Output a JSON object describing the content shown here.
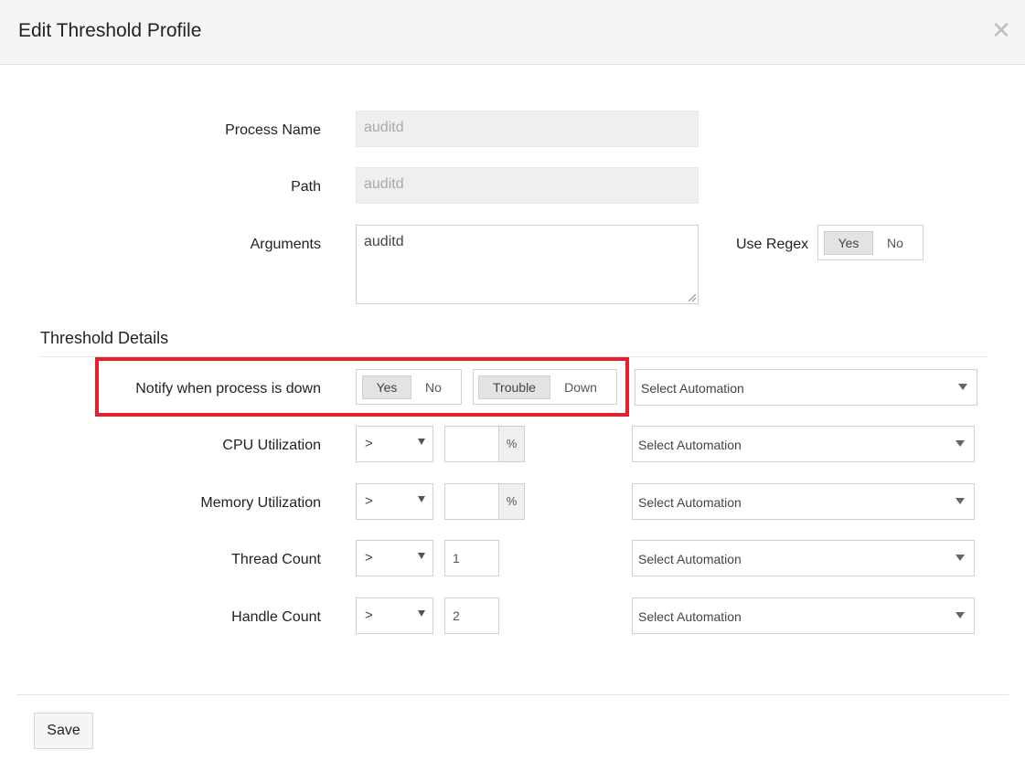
{
  "header": {
    "title": "Edit Threshold Profile",
    "close_glyph": "✕"
  },
  "process": {
    "name_label": "Process Name",
    "name_value": "auditd",
    "path_label": "Path",
    "path_value": "auditd",
    "arguments_label": "Arguments",
    "arguments_value": "auditd",
    "regex_label": "Use Regex",
    "regex_yes": "Yes",
    "regex_no": "No",
    "regex_selected": "Yes"
  },
  "threshold": {
    "section_title": "Threshold Details",
    "notify": {
      "label": "Notify when process is down",
      "yes": "Yes",
      "no": "No",
      "selected": "Yes",
      "trouble": "Trouble",
      "down": "Down",
      "severity_selected": "Trouble",
      "automation": "Select Automation"
    },
    "rows": [
      {
        "label": "CPU Utilization",
        "operator": ">",
        "value": "",
        "unit": "%",
        "automation": "Select Automation"
      },
      {
        "label": "Memory Utilization",
        "operator": ">",
        "value": "",
        "unit": "%",
        "automation": "Select Automation"
      },
      {
        "label": "Thread Count",
        "operator": ">",
        "value": "1",
        "automation": "Select Automation"
      },
      {
        "label": "Handle Count",
        "operator": ">",
        "value": "2",
        "automation": "Select Automation"
      }
    ]
  },
  "footer": {
    "save_label": "Save"
  },
  "colors": {
    "highlight": "#e3212e",
    "header_bg": "#f5f5f5"
  },
  "icons": {
    "close": "close-icon",
    "dropdown": "chevron-down-icon",
    "resize": "resize-grip-icon"
  }
}
